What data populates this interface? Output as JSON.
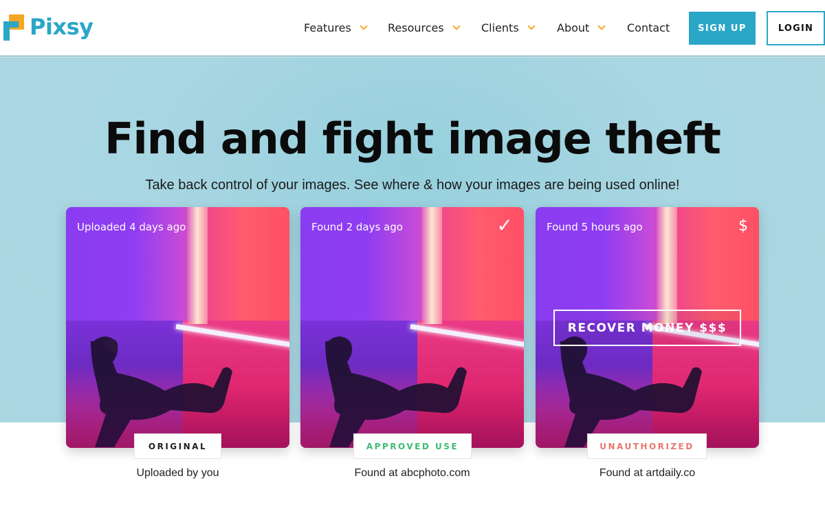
{
  "brand": {
    "name": "Pixsy",
    "accent": "#2aa6c7",
    "secondary": "#f5a623"
  },
  "nav": {
    "items": [
      {
        "label": "Features",
        "has_dropdown": true
      },
      {
        "label": "Resources",
        "has_dropdown": true
      },
      {
        "label": "Clients",
        "has_dropdown": true
      },
      {
        "label": "About",
        "has_dropdown": true
      },
      {
        "label": "Contact",
        "has_dropdown": false
      }
    ],
    "signup_label": "SIGN UP",
    "login_label": "LOGIN"
  },
  "hero": {
    "title": "Find and fight image theft",
    "subtitle": "Take back control of your images. See where & how your images are being used online!"
  },
  "cards": [
    {
      "time": "Uploaded 4 days ago",
      "icon": "",
      "tag": "ORIGINAL",
      "tag_color": "#222222",
      "caption": "Uploaded by you"
    },
    {
      "time": "Found 2 days ago",
      "icon": "✓",
      "tag": "APPROVED USE",
      "tag_color": "#3dbb73",
      "caption": "Found at abcphoto.com"
    },
    {
      "time": "Found 5 hours ago",
      "icon": "$",
      "tag": "UNAUTHORIZED",
      "tag_color": "#e8776f",
      "caption": "Found at artdaily.co",
      "action": "RECOVER MONEY $$$"
    }
  ]
}
